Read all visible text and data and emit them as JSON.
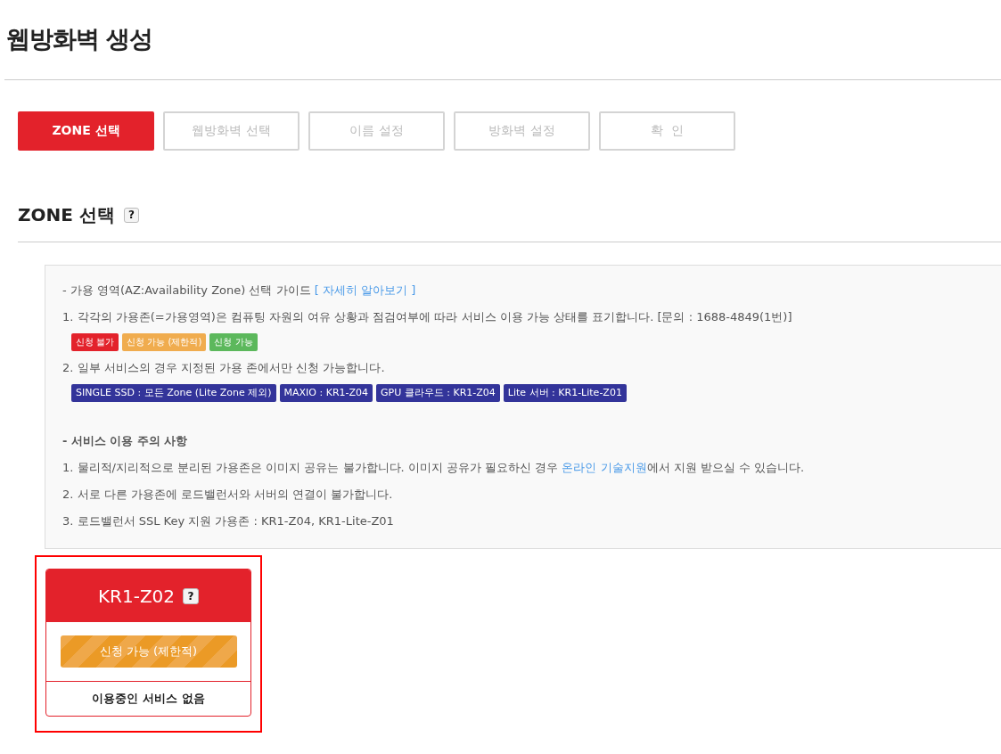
{
  "page_title": "웹방화벽 생성",
  "steps": [
    {
      "label": "ZONE 선택",
      "selected": true
    },
    {
      "label": "웹방화벽 선택",
      "selected": false
    },
    {
      "label": "이름 설정",
      "selected": false
    },
    {
      "label": "방화벽 설정",
      "selected": false
    },
    {
      "label": "확  인",
      "selected": false
    }
  ],
  "section": {
    "title": "ZONE 선택",
    "help": "?"
  },
  "guide": {
    "heading": [
      {
        "kind": "text",
        "text": "- 가용 영역(AZ:Availability Zone) 선택 가이드 "
      },
      {
        "kind": "link",
        "text": "[ 자세히 알아보기 ]"
      }
    ],
    "line_1": "1. 각각의 가용존(=가용영역)은 컴퓨팅 자원의 여유 상황과 점검여부에 따라 서비스 이용 가능 상태를 표기합니다. [문의 : 1688-4849(1번)]",
    "legend": [
      {
        "label": "신청 불가",
        "color": "#e3222b"
      },
      {
        "label": "신청 가능 (제한적)",
        "color": "#f0ac4e"
      },
      {
        "label": "신청 가능",
        "color": "#5cb85c"
      }
    ],
    "line_2": "2. 일부 서비스의 경우 지정된 가용 존에서만 신청 가능합니다.",
    "service_tags": [
      "SINGLE SSD : 모든 Zone (Lite Zone 제외)",
      "MAXIO : KR1-Z04",
      "GPU 클라우드 : KR1-Z04",
      "Lite 서버 : KR1-Lite-Z01"
    ]
  },
  "notes": {
    "heading": "- 서비스 이용 주의 사항",
    "lines": [
      [
        {
          "kind": "text",
          "text": "1. 물리적/지리적으로 분리된 가용존은 이미지 공유는 불가합니다. 이미지 공유가 필요하신 경우 "
        },
        {
          "kind": "link",
          "text": "온라인 기술지원"
        },
        {
          "kind": "text",
          "text": "에서 지원 받으실 수 있습니다."
        }
      ],
      [
        {
          "kind": "text",
          "text": "2. 서로 다른 가용존에 로드밸런서와 서버의 연결이 불가합니다."
        }
      ],
      [
        {
          "kind": "text",
          "text": "3. 로드밸런서 SSL Key 지원 가용존 : KR1-Z04, KR1-Lite-Z01"
        }
      ]
    ]
  },
  "zones": [
    {
      "name": "KR1-Z02",
      "help": "?",
      "selected": true,
      "kind": "limited",
      "status_label": "신청 가능 (제한적)",
      "usage": "이용중인 서비스 없음"
    }
  ]
}
